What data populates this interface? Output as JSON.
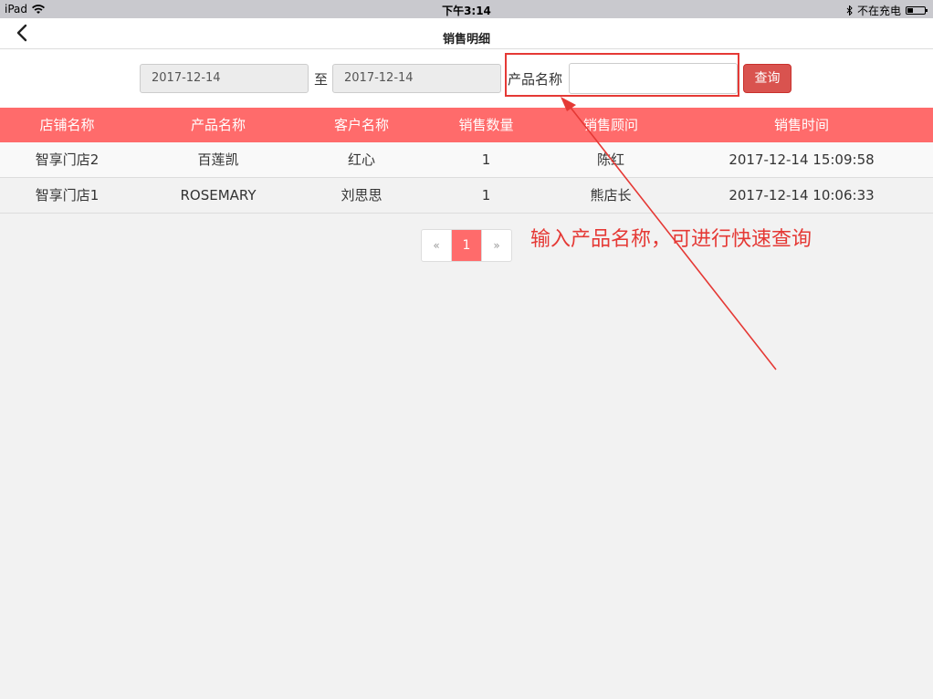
{
  "status_bar": {
    "device": "iPad",
    "time": "下午3:14",
    "charging": "不在充电"
  },
  "nav": {
    "title": "销售明细"
  },
  "filters": {
    "date_from": "2017-12-14",
    "to_label": "至",
    "date_to": "2017-12-14",
    "product_label": "产品名称",
    "product_value": "",
    "search_label": "查询"
  },
  "table": {
    "headers": [
      "店铺名称",
      "产品名称",
      "客户名称",
      "销售数量",
      "销售顾问",
      "销售时间"
    ],
    "rows": [
      [
        "智享门店2",
        "百莲凯",
        "红心",
        "1",
        "陈红",
        "2017-12-14 15:09:58"
      ],
      [
        "智享门店1",
        "ROSEMARY",
        "刘思思",
        "1",
        "熊店长",
        "2017-12-14 10:06:33"
      ]
    ]
  },
  "pagination": {
    "prev": "«",
    "current": "1",
    "next": "»"
  },
  "annotation": {
    "text": "输入产品名称，可进行快速查询",
    "color": "#e53935"
  },
  "colors": {
    "accent": "#ff6b6b",
    "button": "#d9534f"
  }
}
